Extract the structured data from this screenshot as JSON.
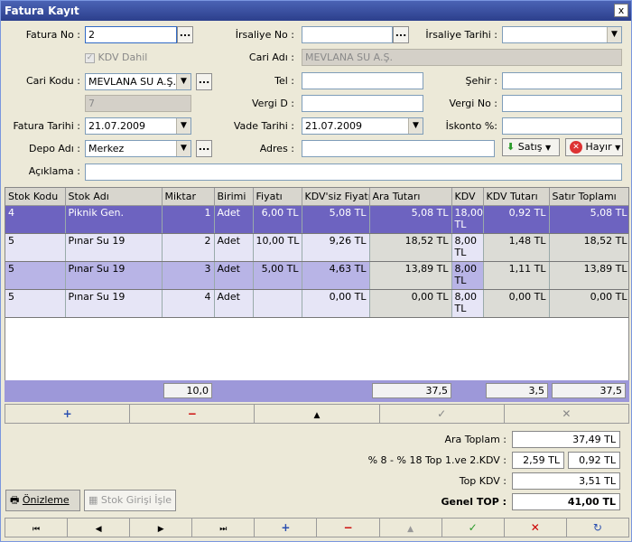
{
  "window": {
    "title": "Fatura Kayıt",
    "close": "x"
  },
  "form": {
    "fatura_no_label": "Fatura No :",
    "fatura_no": "2",
    "kdv_dahil_label": "KDV Dahil",
    "cari_kodu_label": "Cari Kodu :",
    "cari_kodu": "MEVLANA SU A.Ş.",
    "cari_sub": "7",
    "fatura_tarihi_label": "Fatura Tarihi :",
    "fatura_tarihi": "21.07.2009",
    "depo_adi_label": "Depo Adı :",
    "depo_adi": "Merkez",
    "aciklama_label": "Açıklama :",
    "aciklama": "",
    "irsaliye_no_label": "İrsaliye No :",
    "irsaliye_no": "",
    "cari_adi_label": "Cari Adı :",
    "cari_adi": "MEVLANA SU A.Ş.",
    "tel_label": "Tel :",
    "tel": "",
    "vergi_d_label": "Vergi D :",
    "vergi_d": "",
    "vade_tarihi_label": "Vade Tarihi :",
    "vade_tarihi": "21.07.2009",
    "adres_label": "Adres :",
    "adres": "",
    "irsaliye_tarihi_label": "İrsaliye Tarihi :",
    "irsaliye_tarihi": "",
    "sehir_label": "Şehir :",
    "sehir": "",
    "vergi_no_label": "Vergi No :",
    "vergi_no": "",
    "iskonto_label": "İskonto %:",
    "iskonto": "",
    "satis_label": "Satış",
    "hayir_label": "Hayır",
    "ellipsis": "..."
  },
  "grid": {
    "columns": [
      "Stok Kodu",
      "Stok Adı",
      "Miktar",
      "Birimi",
      "Fiyatı",
      "KDV'siz Fiyatı",
      "Ara Tutarı",
      "KDV",
      "KDV Tutarı",
      "Satır Toplamı"
    ],
    "rows": [
      [
        "4",
        "Piknik Gen.",
        "1",
        "Adet",
        "6,00 TL",
        "5,08 TL",
        "5,08 TL",
        "18,00 TL",
        "0,92 TL",
        "5,08 TL"
      ],
      [
        "5",
        "Pınar Su 19",
        "2",
        "Adet",
        "10,00 TL",
        "9,26 TL",
        "18,52 TL",
        "8,00 TL",
        "1,48 TL",
        "18,52 TL"
      ],
      [
        "5",
        "Pınar Su 19",
        "3",
        "Adet",
        "5,00 TL",
        "4,63 TL",
        "13,89 TL",
        "8,00 TL",
        "1,11 TL",
        "13,89 TL"
      ],
      [
        "5",
        "Pınar Su 19",
        "4",
        "Adet",
        "",
        "0,00 TL",
        "0,00 TL",
        "8,00 TL",
        "0,00 TL",
        "0,00 TL"
      ]
    ],
    "totals": {
      "miktar": "10,0",
      "ara": "37,5",
      "kdv": "3,5",
      "satir": "37,5"
    }
  },
  "grid_nav": [
    "add-icon",
    "minus-icon",
    "up-icon",
    "check-icon",
    "cancel-icon"
  ],
  "summary": {
    "ara_toplam_label": "Ara Toplam :",
    "ara_toplam": "37,49 TL",
    "kdv_split_label": "% 8 - % 18 Top 1.ve 2.KDV :",
    "kdv1": "2,59 TL",
    "kdv2": "0,92 TL",
    "top_kdv_label": "Top KDV :",
    "top_kdv": "3,51 TL",
    "genel_top_label": "Genel TOP :",
    "genel_top": "41,00 TL"
  },
  "buttons": {
    "onizleme": "Önizleme",
    "stok_girisi": "Stok Girişi İşle"
  },
  "colors": {
    "title": "#2c3f8c",
    "selected_row": "#6d63c0",
    "alt_row": "#e6e5f6",
    "totals_bar": "#9d98d9"
  }
}
